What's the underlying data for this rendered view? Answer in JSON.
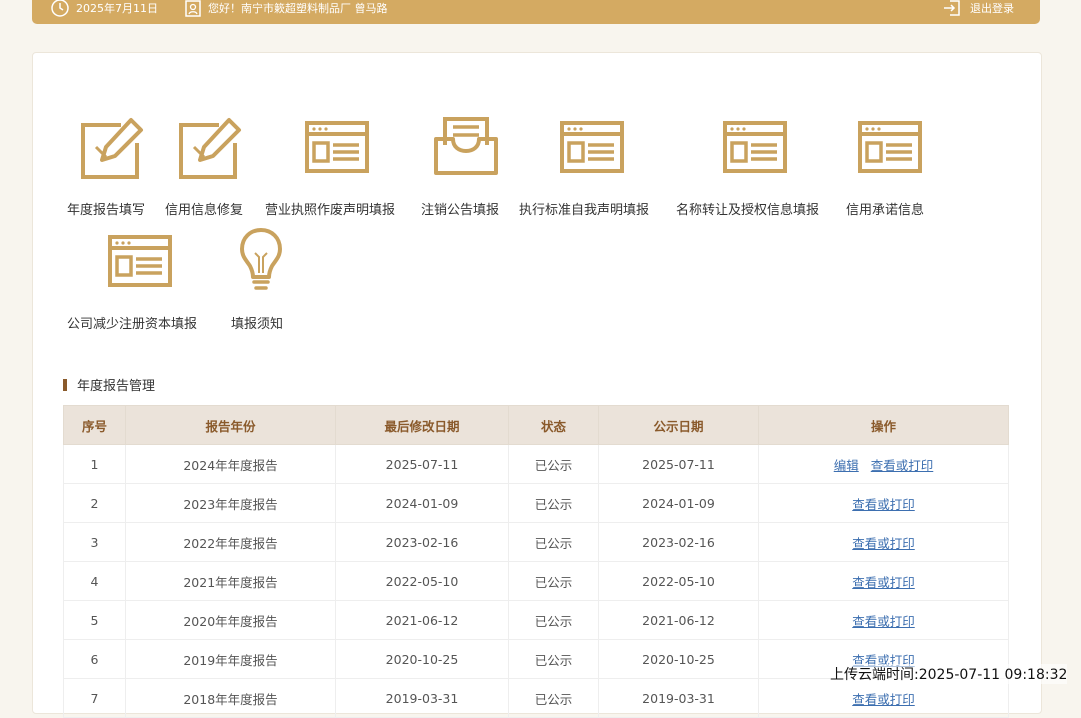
{
  "header": {
    "date": "2025年7月11日",
    "greeting": "您好！南宁市簌超塑料制品厂  曾马路",
    "logout": "退出登录"
  },
  "tiles": [
    {
      "label": "年度报告填写",
      "icon": "edit-icon"
    },
    {
      "label": "信用信息修复",
      "icon": "edit-icon"
    },
    {
      "label": "营业执照作废声明填报",
      "icon": "form-window-icon"
    },
    {
      "label": "注销公告填报",
      "icon": "inbox-tray-icon"
    },
    {
      "label": "执行标准自我声明填报",
      "icon": "form-window-icon"
    },
    {
      "label": "名称转让及授权信息填报",
      "icon": "form-window-icon"
    },
    {
      "label": "信用承诺信息",
      "icon": "form-window-icon"
    },
    {
      "label": "公司减少注册资本填报",
      "icon": "form-window-icon"
    },
    {
      "label": "填报须知",
      "icon": "lightbulb-icon"
    }
  ],
  "section": {
    "title": "年度报告管理"
  },
  "table": {
    "headers": [
      "序号",
      "报告年份",
      "最后修改日期",
      "状态",
      "公示日期",
      "操作"
    ],
    "rows": [
      {
        "no": "1",
        "year": "2024年年度报告",
        "modified": "2025-07-11",
        "status": "已公示",
        "published": "2025-07-11",
        "edit": "编辑",
        "view": "查看或打印"
      },
      {
        "no": "2",
        "year": "2023年年度报告",
        "modified": "2024-01-09",
        "status": "已公示",
        "published": "2024-01-09",
        "view": "查看或打印"
      },
      {
        "no": "3",
        "year": "2022年年度报告",
        "modified": "2023-02-16",
        "status": "已公示",
        "published": "2023-02-16",
        "view": "查看或打印"
      },
      {
        "no": "4",
        "year": "2021年年度报告",
        "modified": "2022-05-10",
        "status": "已公示",
        "published": "2022-05-10",
        "view": "查看或打印"
      },
      {
        "no": "5",
        "year": "2020年年度报告",
        "modified": "2021-06-12",
        "status": "已公示",
        "published": "2021-06-12",
        "view": "查看或打印"
      },
      {
        "no": "6",
        "year": "2019年年度报告",
        "modified": "2020-10-25",
        "status": "已公示",
        "published": "2020-10-25",
        "view": "查看或打印"
      },
      {
        "no": "7",
        "year": "2018年年度报告",
        "modified": "2019-03-31",
        "status": "已公示",
        "published": "2019-03-31",
        "view": "查看或打印"
      }
    ]
  },
  "upload_time": "上传云端时间:2025-07-11 09:18:32",
  "colors": {
    "accent": "#d4aa62",
    "icon": "#c9a25e",
    "header_text": "#8a5a2b",
    "link": "#3d6fb0"
  }
}
